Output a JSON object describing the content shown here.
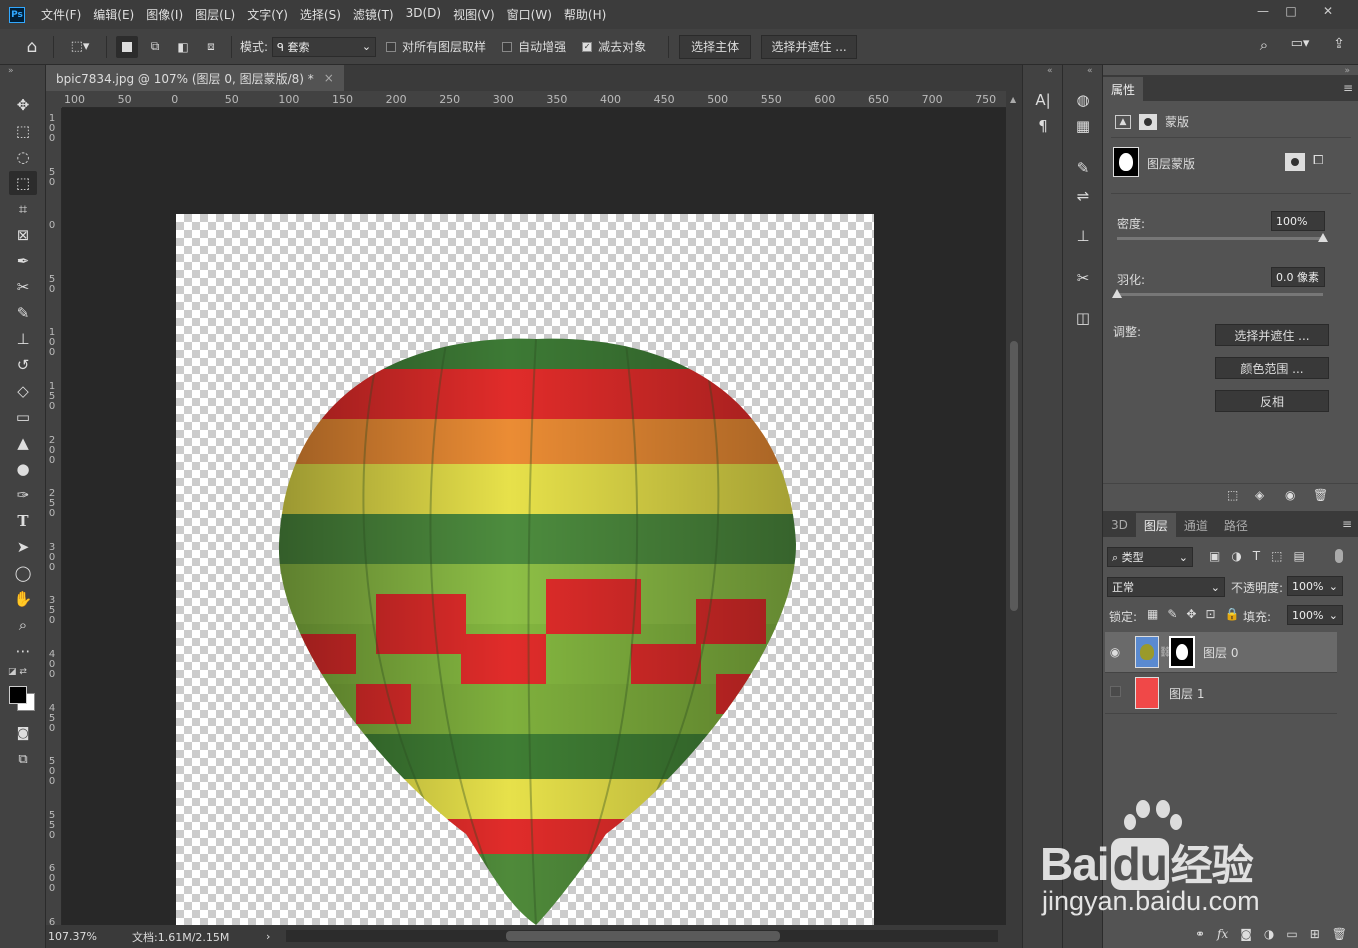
{
  "app": {
    "logo": "Ps"
  },
  "menu": [
    "文件(F)",
    "编辑(E)",
    "图像(I)",
    "图层(L)",
    "文字(Y)",
    "选择(S)",
    "滤镜(T)",
    "3D(D)",
    "视图(V)",
    "窗口(W)",
    "帮助(H)"
  ],
  "window": {
    "minimize": "—",
    "restore": "□",
    "close": "✕"
  },
  "options": {
    "mode_label": "模式:",
    "mode_value": "套索",
    "sample_all_label": "对所有图层取样",
    "auto_enhance_label": "自动增强",
    "subtract_label": "减去对象",
    "subtract_checked": true,
    "select_subject": "选择主体",
    "select_mask": "选择并遮住 ..."
  },
  "document": {
    "tab_title": "bpic7834.jpg @ 107% (图层 0, 图层蒙版/8) *",
    "tab_close": "×",
    "ruler_top": [
      "100",
      "50",
      "0",
      "50",
      "100",
      "150",
      "200",
      "250",
      "300",
      "350",
      "400",
      "450",
      "500",
      "550",
      "600",
      "650",
      "700",
      "750"
    ],
    "ruler_left": [
      "1\n0\n0",
      "5\n0",
      "0",
      "5\n0",
      "1\n0\n0",
      "1\n5\n0",
      "2\n0\n0",
      "2\n5\n0",
      "3\n0\n0",
      "3\n5\n0",
      "4\n0\n0",
      "4\n5\n0",
      "5\n0\n0",
      "5\n5\n0",
      "6\n0\n0",
      "6"
    ]
  },
  "status": {
    "zoom": "107.37%",
    "doc_info": "文档:1.61M/2.15M",
    "arrow": "›"
  },
  "properties": {
    "tab": "属性",
    "mask_type": "蒙版",
    "layer_mask_label": "图层蒙版",
    "density_label": "密度:",
    "density_value": "100%",
    "density": 1.0,
    "feather_label": "羽化:",
    "feather_value": "0.0 像素",
    "feather": 0.0,
    "adjust_label": "调整:",
    "btn_select_mask": "选择并遮住 ...",
    "btn_color_range": "颜色范围 ...",
    "btn_invert": "反相"
  },
  "layers_panel": {
    "tabs": [
      "3D",
      "图层",
      "通道",
      "路径"
    ],
    "active_tab": 1,
    "filter_kind": "类型",
    "blend_mode": "正常",
    "opacity_label": "不透明度:",
    "opacity_value": "100%",
    "lock_label": "锁定:",
    "fill_label": "填充:",
    "fill_value": "100%",
    "layers": [
      {
        "name": "图层 0",
        "visible": true,
        "selected": true
      },
      {
        "name": "图层 1",
        "visible": false,
        "selected": false,
        "color": "#f04848"
      }
    ]
  },
  "watermark": {
    "brand": "Bai",
    "brand2": "du",
    "brand3": "经验",
    "url": "jingyan.baidu.com"
  }
}
